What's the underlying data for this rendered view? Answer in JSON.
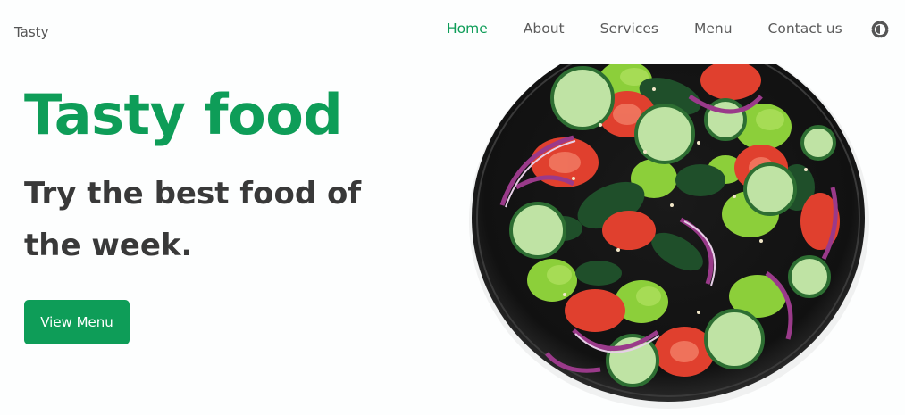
{
  "brand": {
    "name": "Tasty"
  },
  "nav": {
    "items": [
      {
        "label": "Home",
        "active": true
      },
      {
        "label": "About",
        "active": false
      },
      {
        "label": "Services",
        "active": false
      },
      {
        "label": "Menu",
        "active": false
      },
      {
        "label": "Contact us",
        "active": false
      }
    ],
    "theme_toggle_icon": "sun-moon-icon"
  },
  "hero": {
    "title": "Tasty food",
    "subtitle": "Try the best food of the week.",
    "cta_label": "View Menu",
    "image_icon": "salad-bowl-image"
  },
  "colors": {
    "accent": "#0e9d58",
    "text_dark": "#393939",
    "nav_text": "#5b5b5b",
    "background": "#fdfefe"
  }
}
